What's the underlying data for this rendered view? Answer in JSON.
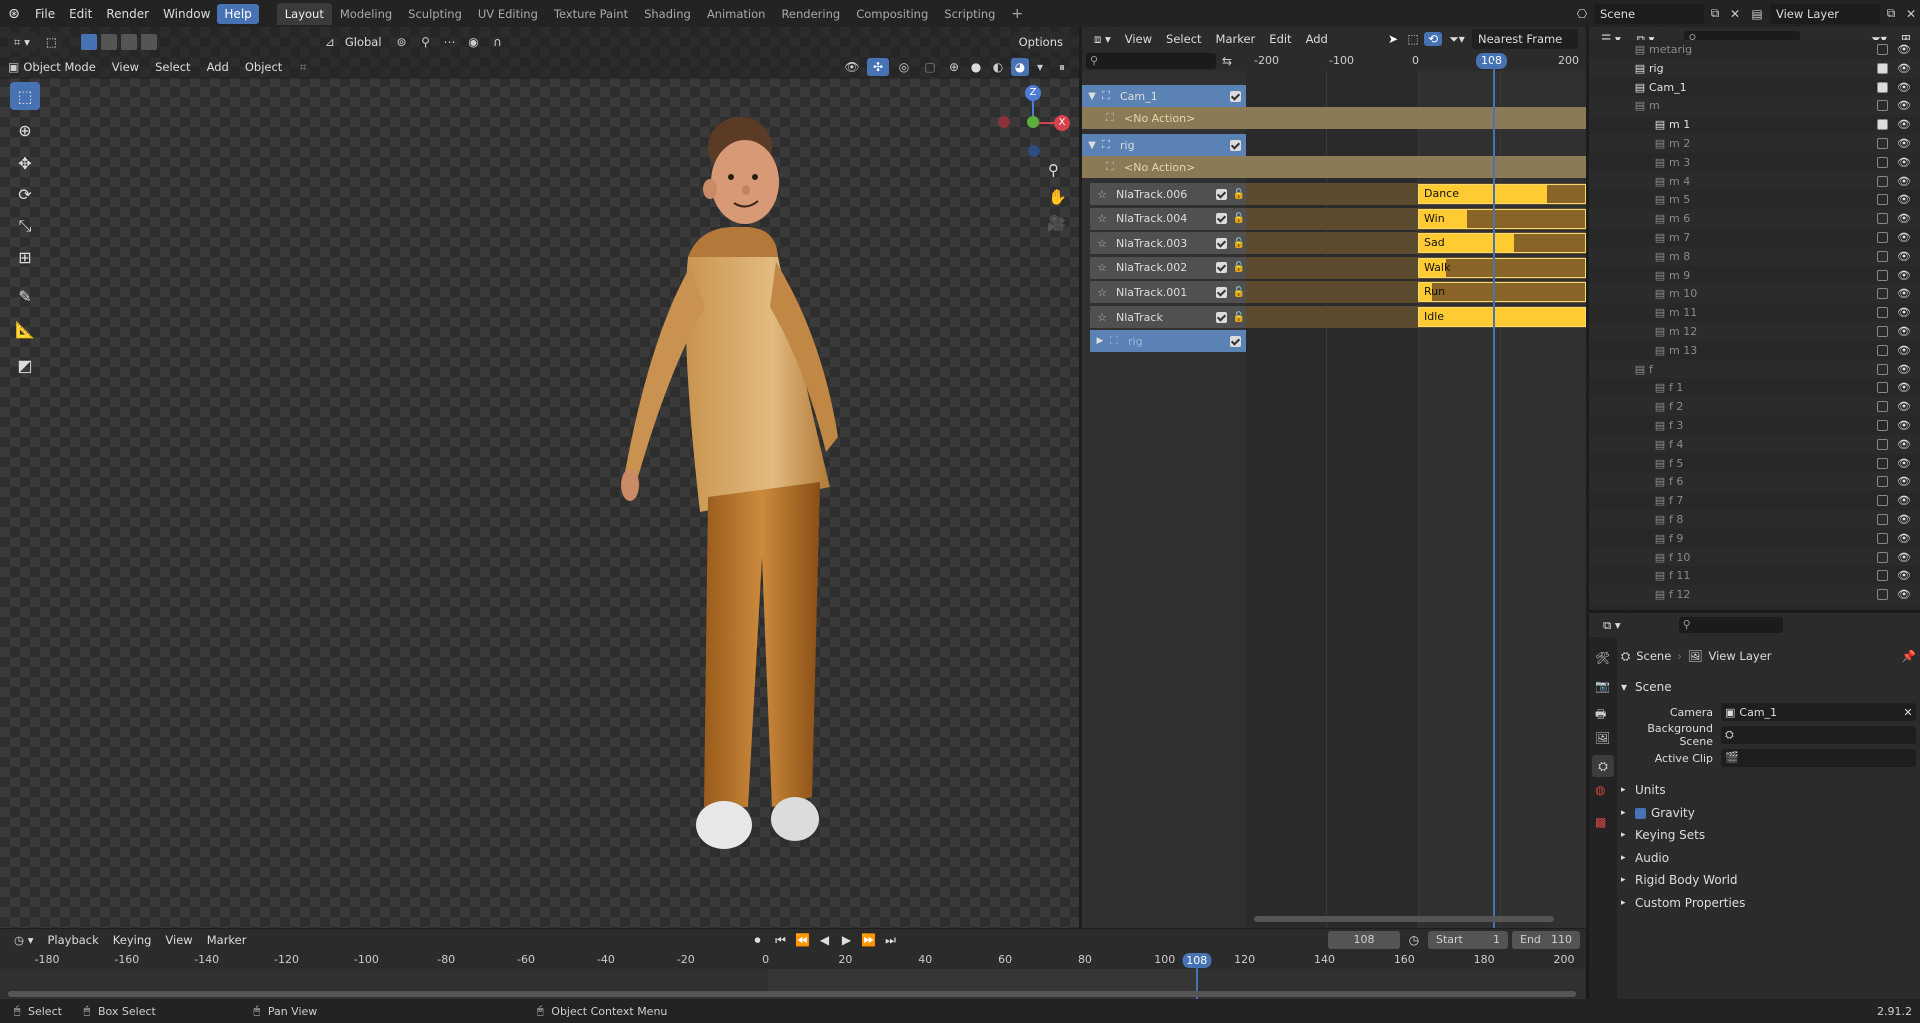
{
  "topbar": {
    "menus": [
      "File",
      "Edit",
      "Render",
      "Window",
      "Help"
    ],
    "workspaces": [
      "Layout",
      "Modeling",
      "Sculpting",
      "UV Editing",
      "Texture Paint",
      "Shading",
      "Animation",
      "Rendering",
      "Compositing",
      "Scripting"
    ],
    "add_workspace": "+",
    "scene_label": "Scene",
    "view_layer_label": "View Layer"
  },
  "viewport": {
    "mode": "Object Mode",
    "menus": [
      "View",
      "Select",
      "Add",
      "Object"
    ],
    "transform_orientation": "Global",
    "options_label": "Options",
    "gizmo": {
      "z": "Z",
      "x": "X"
    }
  },
  "nla": {
    "menus": [
      "View",
      "Select",
      "Marker",
      "Edit",
      "Add"
    ],
    "snap_mode": "Nearest Frame",
    "ruler": [
      "-200",
      "-100",
      "0",
      "108",
      "200"
    ],
    "current_frame": "108",
    "objects": [
      {
        "name": "Cam_1",
        "action": "<No Action>"
      },
      {
        "name": "rig",
        "action": "<No Action>"
      }
    ],
    "tracks": [
      {
        "name": "NlaTrack.006",
        "strip": "Dance",
        "fill": 0.77
      },
      {
        "name": "NlaTrack.004",
        "strip": "Win",
        "fill": 0.29
      },
      {
        "name": "NlaTrack.003",
        "strip": "Sad",
        "fill": 0.57
      },
      {
        "name": "NlaTrack.002",
        "strip": "Walk",
        "fill": 0.16
      },
      {
        "name": "NlaTrack.001",
        "strip": "Run",
        "fill": 0.08
      },
      {
        "name": "NlaTrack",
        "strip": "Idle",
        "fill": 1.0
      }
    ],
    "sub_rig": "rig"
  },
  "outliner": {
    "rows": [
      {
        "label": "metarig",
        "indent": 1,
        "dim": true,
        "check": false
      },
      {
        "label": "rig",
        "indent": 1,
        "dim": false,
        "check": true
      },
      {
        "label": "Cam_1",
        "indent": 1,
        "dim": false,
        "check": true
      },
      {
        "label": "m",
        "indent": 1,
        "dim": true,
        "check": false
      },
      {
        "label": "m 1",
        "indent": 2,
        "dim": false,
        "check": true
      },
      {
        "label": "m 2",
        "indent": 2,
        "dim": true,
        "check": false
      },
      {
        "label": "m 3",
        "indent": 2,
        "dim": true,
        "check": false
      },
      {
        "label": "m 4",
        "indent": 2,
        "dim": true,
        "check": false
      },
      {
        "label": "m 5",
        "indent": 2,
        "dim": true,
        "check": false
      },
      {
        "label": "m 6",
        "indent": 2,
        "dim": true,
        "check": false
      },
      {
        "label": "m 7",
        "indent": 2,
        "dim": true,
        "check": false
      },
      {
        "label": "m 8",
        "indent": 2,
        "dim": true,
        "check": false
      },
      {
        "label": "m 9",
        "indent": 2,
        "dim": true,
        "check": false
      },
      {
        "label": "m 10",
        "indent": 2,
        "dim": true,
        "check": false
      },
      {
        "label": "m 11",
        "indent": 2,
        "dim": true,
        "check": false
      },
      {
        "label": "m 12",
        "indent": 2,
        "dim": true,
        "check": false
      },
      {
        "label": "m 13",
        "indent": 2,
        "dim": true,
        "check": false
      },
      {
        "label": "f",
        "indent": 1,
        "dim": true,
        "check": false
      },
      {
        "label": "f 1",
        "indent": 2,
        "dim": true,
        "check": false
      },
      {
        "label": "f 2",
        "indent": 2,
        "dim": true,
        "check": false
      },
      {
        "label": "f 3",
        "indent": 2,
        "dim": true,
        "check": false
      },
      {
        "label": "f 4",
        "indent": 2,
        "dim": true,
        "check": false
      },
      {
        "label": "f 5",
        "indent": 2,
        "dim": true,
        "check": false
      },
      {
        "label": "f 6",
        "indent": 2,
        "dim": true,
        "check": false
      },
      {
        "label": "f 7",
        "indent": 2,
        "dim": true,
        "check": false
      },
      {
        "label": "f 8",
        "indent": 2,
        "dim": true,
        "check": false
      },
      {
        "label": "f 9",
        "indent": 2,
        "dim": true,
        "check": false
      },
      {
        "label": "f 10",
        "indent": 2,
        "dim": true,
        "check": false
      },
      {
        "label": "f 11",
        "indent": 2,
        "dim": true,
        "check": false
      },
      {
        "label": "f 12",
        "indent": 2,
        "dim": true,
        "check": false
      }
    ]
  },
  "properties": {
    "breadcrumb_scene": "Scene",
    "breadcrumb_view_layer": "View Layer",
    "section_scene": "Scene",
    "camera_label": "Camera",
    "camera_value": "Cam_1",
    "background_scene_label": "Background Scene",
    "active_clip_label": "Active Clip",
    "panels": [
      "Units",
      "Gravity",
      "Keying Sets",
      "Audio",
      "Rigid Body World",
      "Custom Properties"
    ]
  },
  "timeline": {
    "menus": [
      "Playback",
      "Keying",
      "View",
      "Marker"
    ],
    "current_frame": "108",
    "start_label": "Start",
    "start_value": "1",
    "end_label": "End",
    "end_value": "110",
    "ruler": [
      "-180",
      "-160",
      "-140",
      "-120",
      "-100",
      "-80",
      "-60",
      "-40",
      "-20",
      "0",
      "20",
      "40",
      "60",
      "80",
      "100",
      "108",
      "120",
      "140",
      "160",
      "180",
      "200"
    ]
  },
  "statusbar": {
    "select": "Select",
    "box_select": "Box Select",
    "pan_view": "Pan View",
    "context_menu": "Object Context Menu",
    "version": "2.91.2"
  },
  "colors": {
    "accent": "#4772b3",
    "strip": "#f2c23a",
    "nla_object_row": "#5a82b4",
    "action_row": "#8a7a55"
  }
}
